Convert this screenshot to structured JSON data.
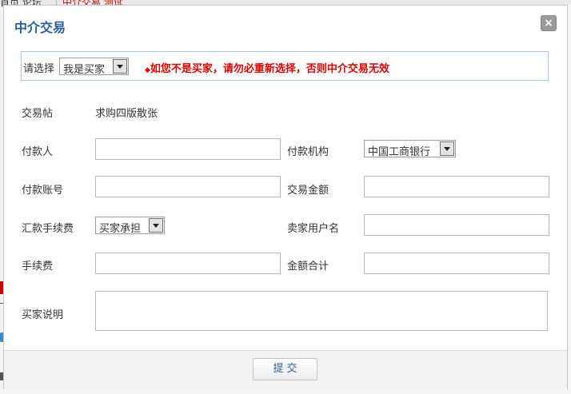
{
  "background": {
    "top_left_text": "首页 论坛",
    "top_right_text": "中介交易 测试"
  },
  "dialog": {
    "title": "中介交易",
    "close_symbol": "×"
  },
  "choose": {
    "label": "请选择",
    "role_value": "我是买家",
    "warning_bullet": "◆",
    "warning": "如您不是买家，请勿必重新选择，否则中介交易无效"
  },
  "form": {
    "trade_post_label": "交易帖",
    "trade_post_value": "求购四版散张",
    "payer_label": "付款人",
    "payer_value": "",
    "pay_org_label": "付款机构",
    "pay_org_value": "中国工商银行",
    "pay_account_label": "付款账号",
    "pay_account_value": "",
    "amount_label": "交易金额",
    "amount_value": "",
    "fee_bearer_label": "汇款手续费",
    "fee_bearer_value": "买家承担",
    "seller_label": "卖家用户名",
    "seller_value": "",
    "fee_label": "手续费",
    "fee_value": "",
    "total_label": "金额合计",
    "total_value": "",
    "buyer_note_label": "买家说明",
    "buyer_note_value": ""
  },
  "footer": {
    "submit_label": "提交"
  }
}
